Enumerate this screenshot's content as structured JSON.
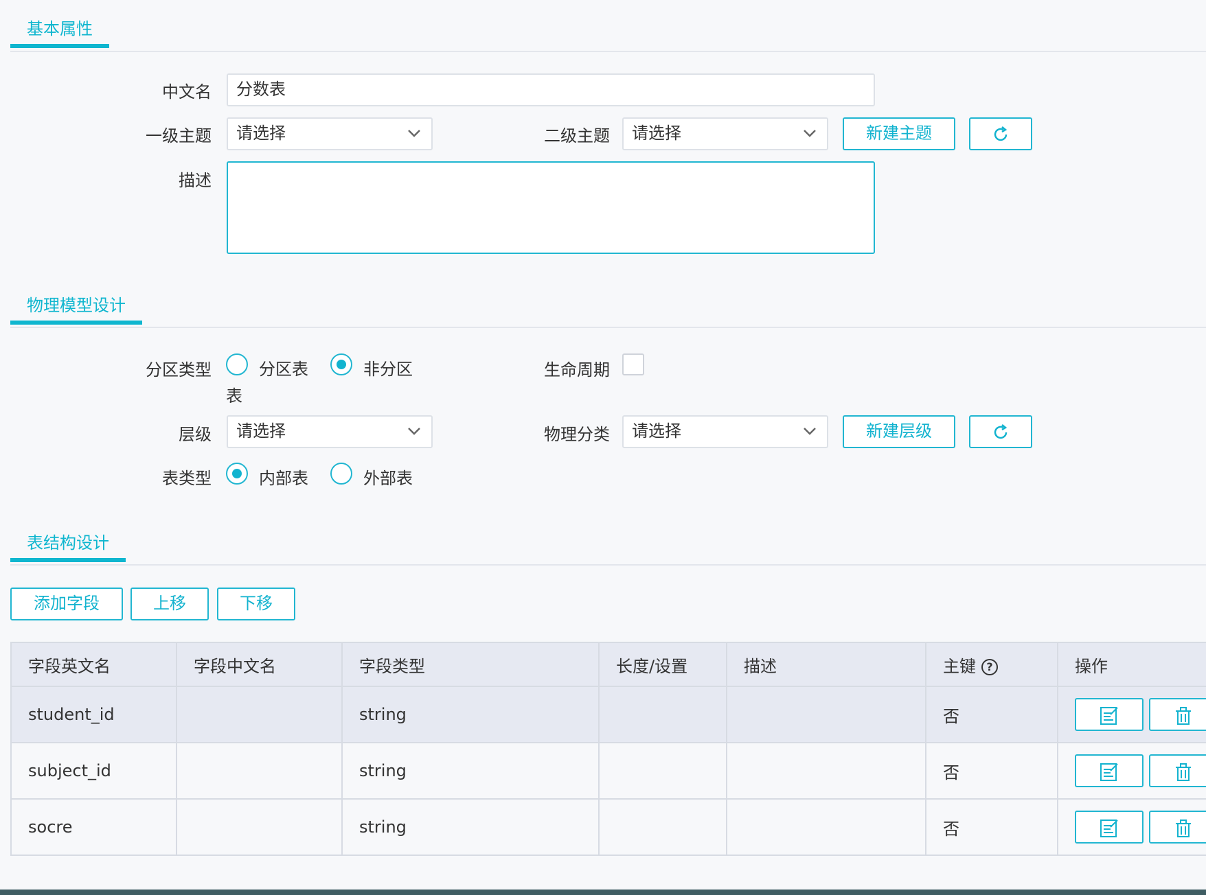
{
  "sections": {
    "basic": "基本属性",
    "physical": "物理模型设计",
    "structure": "表结构设计"
  },
  "basic": {
    "cn_name_label": "中文名",
    "cn_name_value": "分数表",
    "topic1_label": "一级主题",
    "topic1_value": "请选择",
    "topic2_label": "二级主题",
    "topic2_value": "请选择",
    "new_topic_button": "新建主题",
    "refresh_icon": "refresh-icon",
    "desc_label": "描述",
    "desc_value": ""
  },
  "physical": {
    "partition_label": "分区类型",
    "partition_options": [
      "分区表",
      "非分区表"
    ],
    "partition_selected": "非分区表",
    "partition_wrap_tail": "表",
    "lifecycle_label": "生命周期",
    "lifecycle_checked": false,
    "level_label": "层级",
    "level_value": "请选择",
    "phys_class_label": "物理分类",
    "phys_class_value": "请选择",
    "new_level_button": "新建层级",
    "table_type_label": "表类型",
    "table_type_options": [
      "内部表",
      "外部表"
    ],
    "table_type_selected": "内部表"
  },
  "toolbar": {
    "add_field": "添加字段",
    "move_up": "上移",
    "move_down": "下移"
  },
  "table": {
    "headers": [
      "字段英文名",
      "字段中文名",
      "字段类型",
      "长度/设置",
      "描述",
      "主键",
      "操作"
    ],
    "rows": [
      {
        "en": "student_id",
        "cn": "",
        "type": "string",
        "len": "",
        "desc": "",
        "pk": "否"
      },
      {
        "en": "subject_id",
        "cn": "",
        "type": "string",
        "len": "",
        "desc": "",
        "pk": "否"
      },
      {
        "en": "socre",
        "cn": "",
        "type": "string",
        "len": "",
        "desc": "",
        "pk": "否"
      }
    ]
  },
  "colors": {
    "accent": "#0fb6cf",
    "border": "#dde1e7",
    "header_bg": "#e6e9f2"
  }
}
